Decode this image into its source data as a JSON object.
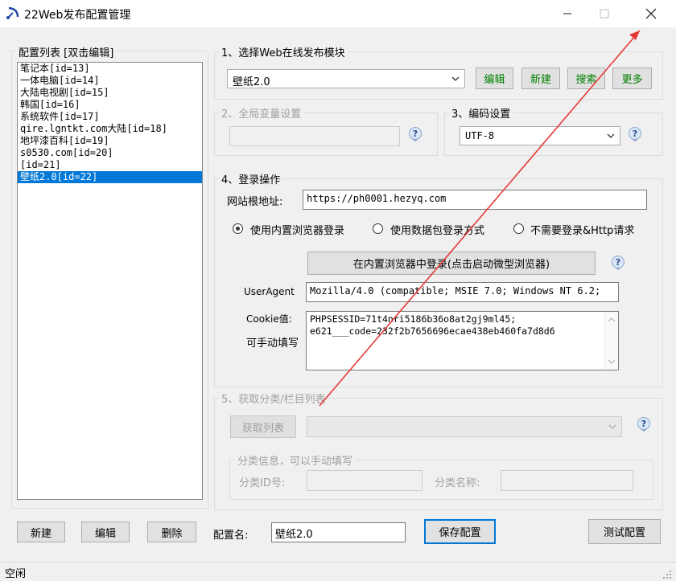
{
  "window": {
    "title": "22Web发布配置管理"
  },
  "config_list": {
    "legend": "配置列表 [双击编辑]",
    "items": [
      "笔记本[id=13]",
      "一体电脑[id=14]",
      "大陆电视剧[id=15]",
      "韩国[id=16]",
      "系统软件[id=17]",
      "qire.lgntkt.com大陆[id=18]",
      "地坪漆百科[id=19]",
      "s0530.com[id=20]",
      "[id=21]",
      "壁纸2.0[id=22]"
    ],
    "selected_index": 9
  },
  "section1": {
    "legend": "1、选择Web在线发布模块",
    "module_value": "壁纸2.0",
    "edit_label": "编辑",
    "new_label": "新建",
    "search_label": "搜索",
    "more_label": "更多"
  },
  "section2": {
    "legend": "2、全局变量设置",
    "value": ""
  },
  "section3": {
    "legend": "3、编码设置",
    "encoding": "UTF-8"
  },
  "section4": {
    "legend": "4、登录操作",
    "root_url_label": "网站根地址:",
    "root_url": "https://ph0001.hezyq.com",
    "radio_builtin": "使用内置浏览器登录",
    "radio_packet": "使用数据包登录方式",
    "radio_none": "不需要登录&Http请求",
    "selected_radio": "builtin",
    "login_button": "在内置浏览器中登录(点击启动微型浏览器)",
    "useragent_label": "UserAgent",
    "useragent": "Mozilla/4.0 (compatible; MSIE 7.0; Windows NT 6.2;",
    "cookie_label": "Cookie值:",
    "cookie_hint": "可手动填写",
    "cookie_line1": "PHPSESSID=71t4nri5186b36o8at2gj9ml45;",
    "cookie_line2": "e621___code=232f2b7656696ecae438eb460fa7d8d6"
  },
  "section5": {
    "legend": "5、获取分类/栏目列表",
    "fetch_label": "获取列表",
    "category_value": "",
    "sub_legend": "分类信息，可以手动填写",
    "category_id_label": "分类ID号:",
    "category_id": "",
    "category_name_label": "分类名称:",
    "category_name": ""
  },
  "bottom": {
    "new_label": "新建",
    "edit_label": "编辑",
    "delete_label": "删除",
    "config_name_label": "配置名:",
    "config_name": "壁纸2.0",
    "save_label": "保存配置",
    "test_label": "测试配置"
  },
  "status": {
    "text": "空闲"
  },
  "colors": {
    "accent": "#0078d7",
    "green_button_text": "#008000",
    "annotation_arrow": "#e53935"
  }
}
